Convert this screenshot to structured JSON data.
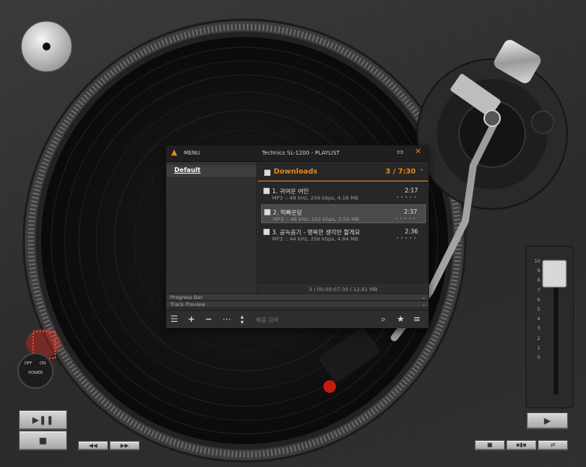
{
  "playlist": {
    "menu_label": "MENU",
    "title": "Technics SL-1200 - PLAYLIST",
    "sidebar_item": "Default",
    "group": {
      "name": "Downloads",
      "count": "3 / 7:30"
    },
    "tracks": [
      {
        "title": "1. 귀여운 여인",
        "info": "MP3 :: 48 kHz, 256 kbps, 4.18 MB",
        "duration": "2:17",
        "selected": false
      },
      {
        "title": "2. 떡빠운당",
        "info": "MP3 :: 48 kHz, 192 kbps, 3.59 MB",
        "duration": "2:37",
        "selected": true
      },
      {
        "title": "3. 공녹음기 - 행복한 생각만 할게요",
        "info": "MP3 :: 44 kHz, 256 kbps, 4.84 MB",
        "duration": "2:36",
        "selected": false
      }
    ],
    "status": "3 / 00:00:07:30 / 12.61 MB",
    "progress_bar_label": "Progress Bar",
    "track_preview_label": "Track Preview",
    "search_placeholder": "빠른 검색"
  },
  "power_label": {
    "off": "OFF",
    "on": "ON",
    "power": "POWER"
  },
  "pitch_scale": [
    "10",
    "9",
    "8",
    "7",
    "6",
    "5",
    "4",
    "3",
    "2",
    "1",
    "0"
  ],
  "colors": {
    "accent": "#e8871e",
    "power_led": "#ff2a1a"
  },
  "icons": [
    "cd-icon",
    "play-pause-icon",
    "stop-icon",
    "rewind-icon",
    "forward-icon",
    "list-icon",
    "add-icon",
    "remove-icon",
    "more-icon",
    "sort-icon",
    "search-icon",
    "star-icon",
    "menu-icon",
    "maximize-icon",
    "close-icon",
    "logo-icon"
  ]
}
